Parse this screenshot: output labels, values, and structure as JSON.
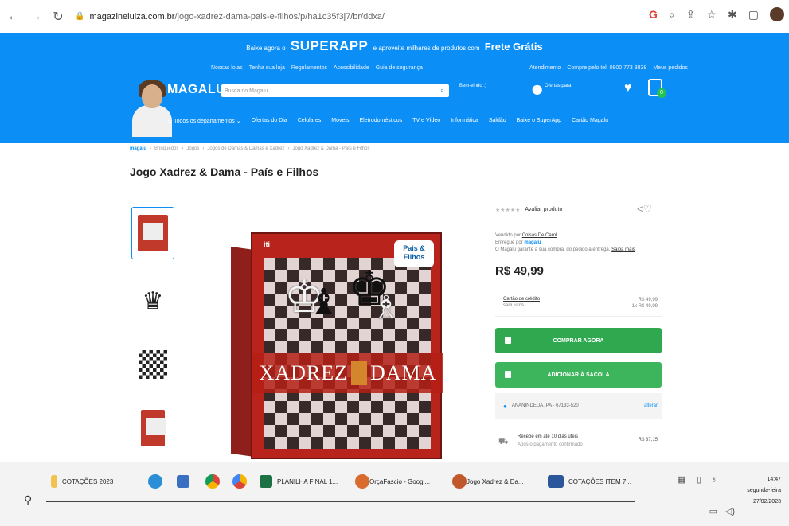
{
  "browser": {
    "url_domain": "magazineluiza.com.br",
    "url_path": "/jogo-xadrez-dama-pais-e-filhos/p/ha1c35f3j7/br/ddxa/"
  },
  "header": {
    "promo_prefix": "Baixe agora o",
    "superapp": "SUPERAPP",
    "promo_middle": "e aproveite milhares de produtos com",
    "frete": "Frete Grátis",
    "top_links": [
      "Nossas lojas",
      "Tenha sua loja",
      "Regulamentos",
      "Acessibilidade",
      "Guia de segurança"
    ],
    "top_links_right": [
      "Atendimento",
      "Compre pelo tel: 0800 773 3838",
      "Meus pedidos"
    ],
    "brand": "MAGALU",
    "search_placeholder": "Busca no Magalu",
    "welcome": "Bem-vindo :)",
    "offers": "Ofertas para",
    "cart_count": "0",
    "categories": [
      "☰ Todos os departamentos ⌄",
      "Ofertas do Dia",
      "Celulares",
      "Móveis",
      "Eletrodomésticos",
      "TV e Vídeo",
      "Informática",
      "Saldão",
      "Baixe o SuperApp",
      "Cartão Magalu"
    ]
  },
  "product": {
    "breadcrumb": [
      "magalu",
      "Brinquedos",
      "Jogos",
      "Jogos de Damas & Damas e Xadrez",
      "Jogo Xadrez & Dama - País e Filhos"
    ],
    "title": "Jogo Xadrez & Dama - País e Filhos",
    "box_word_1": "XADREZ",
    "box_word_2": "DAMA",
    "box_brand": "Pais & Filhos",
    "rating_link": "Avaliar produto",
    "seller_label": "Vendido por",
    "seller_name": "Coisas De Carol",
    "delivered_label": "Entregue por",
    "delivered_by": "magalu",
    "guarantee": "O Magalu garante a sua compra, do pedido à entrega.",
    "saiba_mais": "Saiba mais",
    "price": "R$ 49,99",
    "card_label": "Cartão de crédito",
    "card_sub": "sem juros",
    "card_price": "R$ 49,99",
    "card_installments": "1x R$ 49,99",
    "buy_now": "COMPRAR AGORA",
    "add_bag": "ADICIONAR À SACOLA",
    "cep": "ANANINDEUA, PA - 67133-520",
    "cep_change": "alterar",
    "ship_line1": "Recebe em até 10 dias úteis",
    "ship_line2": "Após o pagamento confirmado",
    "ship_price": "R$ 37,15"
  },
  "taskbar": {
    "items": [
      {
        "label": "COTAÇÕES 2023"
      },
      {
        "label": "PLANILHA FINAL 1..."
      },
      {
        "label": "OrçaFascio - Googl..."
      },
      {
        "label": "Jogo Xadrez & Da..."
      },
      {
        "label": "COTAÇÕES ITEM 7..."
      }
    ],
    "time": "14:47",
    "day": "segunda-feira",
    "date": "27/02/2023"
  }
}
